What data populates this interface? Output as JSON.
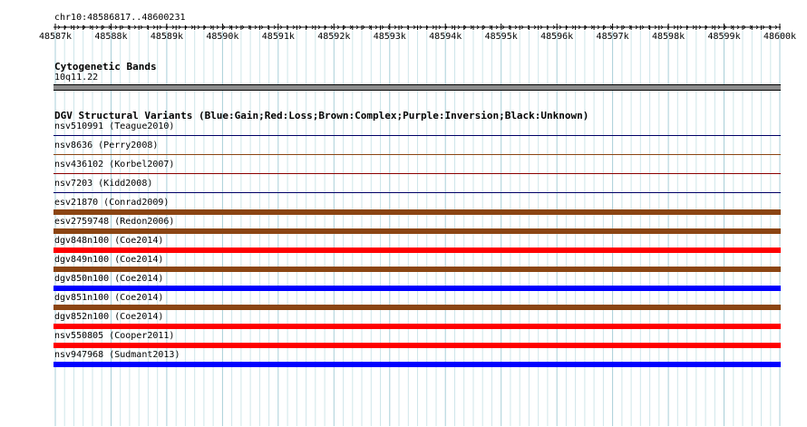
{
  "ruler": {
    "locus": "chr10:48586817..48600231",
    "ticks": [
      "48587k",
      "48588k",
      "48589k",
      "48590k",
      "48591k",
      "48592k",
      "48593k",
      "48594k",
      "48595k",
      "48596k",
      "48597k",
      "48598k",
      "48599k",
      "48600k"
    ]
  },
  "cytogenetic": {
    "title": "Cytogenetic Bands",
    "band": "10q11.22",
    "band_color": "#8c8c8c"
  },
  "dgv": {
    "title": "DGV Structural Variants (Blue:Gain;Red:Loss;Brown:Complex;Purple:Inversion;Black:Unknown)",
    "variants": [
      {
        "label": "nsv510991 (Teague2010)",
        "color": "#000066",
        "type": "line"
      },
      {
        "label": "nsv8636 (Perry2008)",
        "color": "#8b4513",
        "type": "line"
      },
      {
        "label": "nsv436102 (Korbel2007)",
        "color": "#8b0000",
        "type": "line"
      },
      {
        "label": "nsv7203 (Kidd2008)",
        "color": "#000066",
        "type": "line"
      },
      {
        "label": "esv21870 (Conrad2009)",
        "color": "#8b4513",
        "type": "bar"
      },
      {
        "label": "esv2759748 (Redon2006)",
        "color": "#8b4513",
        "type": "bar"
      },
      {
        "label": "dgv848n100 (Coe2014)",
        "color": "#ff0000",
        "type": "bar"
      },
      {
        "label": "dgv849n100 (Coe2014)",
        "color": "#8b4513",
        "type": "bar"
      },
      {
        "label": "dgv850n100 (Coe2014)",
        "color": "#0000ff",
        "type": "bar"
      },
      {
        "label": "dgv851n100 (Coe2014)",
        "color": "#8b4513",
        "type": "bar"
      },
      {
        "label": "dgv852n100 (Coe2014)",
        "color": "#ff0000",
        "type": "bar"
      },
      {
        "label": "nsv550805 (Cooper2011)",
        "color": "#ff0000",
        "type": "bar"
      },
      {
        "label": "nsv947968 (Sudmant2013)",
        "color": "#0000ff",
        "type": "bar"
      }
    ]
  },
  "colors": {
    "grid_minor": "#cfe6ea",
    "grid_major": "#a9cfd8"
  }
}
